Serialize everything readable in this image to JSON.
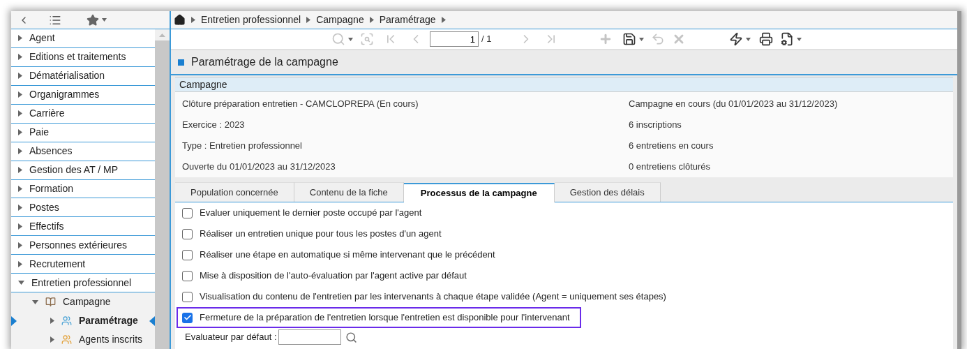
{
  "breadcrumb": [
    "Entretien professionnel",
    "Campagne",
    "Paramétrage"
  ],
  "sidebar": {
    "items": [
      {
        "label": "Agent",
        "expanded": false,
        "selected": false
      },
      {
        "label": "Editions et traitements",
        "expanded": false,
        "selected": false
      },
      {
        "label": "Dématérialisation",
        "expanded": false,
        "selected": false
      },
      {
        "label": "Organigrammes",
        "expanded": false,
        "selected": false
      },
      {
        "label": "Carrière",
        "expanded": false,
        "selected": false
      },
      {
        "label": "Paie",
        "expanded": false,
        "selected": false
      },
      {
        "label": "Absences",
        "expanded": false,
        "selected": false
      },
      {
        "label": "Gestion des AT / MP",
        "expanded": false,
        "selected": false
      },
      {
        "label": "Formation",
        "expanded": false,
        "selected": false
      },
      {
        "label": "Postes",
        "expanded": false,
        "selected": false
      },
      {
        "label": "Effectifs",
        "expanded": false,
        "selected": false
      },
      {
        "label": "Personnes extérieures",
        "expanded": false,
        "selected": false
      },
      {
        "label": "Recrutement",
        "expanded": false,
        "selected": false
      },
      {
        "label": "Entretien professionnel",
        "expanded": true,
        "selected": false,
        "children": [
          {
            "label": "Campagne",
            "kind": "book",
            "expanded": true,
            "selected": false,
            "children": [
              {
                "label": "Paramétrage",
                "kind": "people-gear",
                "expanded": false,
                "selected": true
              },
              {
                "label": "Agents inscrits",
                "kind": "people",
                "expanded": false,
                "selected": false
              }
            ]
          }
        ]
      }
    ]
  },
  "toolbar": {
    "items": [
      {
        "kind": "search",
        "disabled": true
      },
      {
        "kind": "zoom",
        "disabled": true
      },
      {
        "kind": "first",
        "disabled": true
      },
      {
        "kind": "prev",
        "disabled": true
      },
      {
        "kind": "pager"
      },
      {
        "kind": "next",
        "disabled": true
      },
      {
        "kind": "last",
        "disabled": true
      },
      {
        "kind": "add",
        "disabled": true
      },
      {
        "kind": "save",
        "disabled": false
      },
      {
        "kind": "undo",
        "disabled": true
      },
      {
        "kind": "delete",
        "disabled": true
      },
      {
        "kind": "action",
        "disabled": false
      },
      {
        "kind": "print",
        "disabled": false
      },
      {
        "kind": "report",
        "disabled": false
      }
    ],
    "page": "1",
    "total": "/ 1"
  },
  "title": "Paramétrage de la campagne",
  "section": {
    "title": "Campagne",
    "left": [
      "Clôture préparation entretien - CAMCLOPREPA (En cours)",
      "Exercice : 2023",
      "Type : Entretien professionnel",
      "Ouverte du 01/01/2023 au 31/12/2023"
    ],
    "right": [
      "Campagne en cours (du 01/01/2023 au 31/12/2023)",
      "6 inscriptions",
      "6 entretiens en cours",
      "0 entretiens clôturés"
    ]
  },
  "tabs": [
    {
      "label": "Population concernée",
      "selected": false
    },
    {
      "label": "Contenu de la fiche",
      "selected": false
    },
    {
      "label": "Processus de la campagne",
      "selected": true
    },
    {
      "label": "Gestion des délais",
      "selected": false
    }
  ],
  "options": [
    {
      "label": "Evaluer uniquement le dernier poste occupé par l'agent",
      "checked": false,
      "highlighted": false
    },
    {
      "label": "Réaliser un entretien unique pour tous les postes d'un agent",
      "checked": false,
      "highlighted": false
    },
    {
      "label": "Réaliser une étape en automatique si même intervenant que le précédent",
      "checked": false,
      "highlighted": false
    },
    {
      "label": "Mise à disposition de l'auto-évaluation par l'agent active par défaut",
      "checked": false,
      "highlighted": false
    },
    {
      "label": "Visualisation du contenu de l'entretien par les intervenants à chaque étape validée (Agent = uniquement ses étapes)",
      "checked": false,
      "highlighted": false
    },
    {
      "label": "Fermeture de la préparation de l'entretien lorsque l'entretien est disponible pour l'intervenant",
      "checked": true,
      "highlighted": true
    }
  ],
  "evaluator": {
    "label": "Evaluateur par défaut :"
  }
}
